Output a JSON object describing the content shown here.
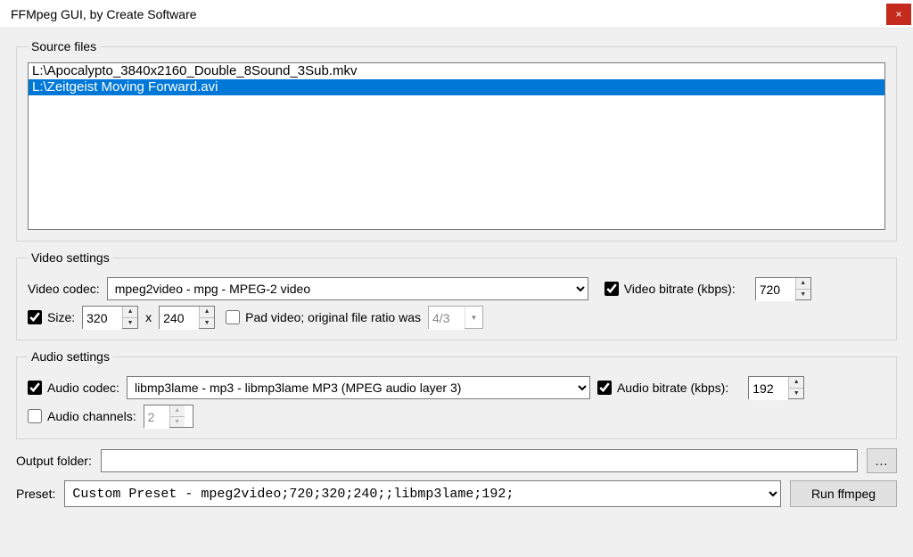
{
  "window": {
    "title": "FFMpeg GUI, by Create Software",
    "close_label": "×"
  },
  "source": {
    "legend": "Source files",
    "files": [
      "L:\\Apocalypto_3840x2160_Double_8Sound_3Sub.mkv",
      "L:\\Zeitgeist Moving Forward.avi"
    ],
    "selected_index": 1
  },
  "video": {
    "legend": "Video settings",
    "codec_label": "Video codec:",
    "codec_value": "mpeg2video - mpg - MPEG-2 video",
    "bitrate_checked": true,
    "bitrate_label": "Video bitrate (kbps):",
    "bitrate_value": "720",
    "size_checked": true,
    "size_label": "Size:",
    "size_w": "320",
    "size_sep": "x",
    "size_h": "240",
    "pad_checked": false,
    "pad_label": "Pad video; original file ratio was",
    "ratio_value": "4/3"
  },
  "audio": {
    "legend": "Audio settings",
    "codec_checked": true,
    "codec_label": "Audio codec:",
    "codec_value": "libmp3lame - mp3 - libmp3lame MP3 (MPEG audio layer 3)",
    "bitrate_checked": true,
    "bitrate_label": "Audio bitrate (kbps):",
    "bitrate_value": "192",
    "channels_checked": false,
    "channels_label": "Audio channels:",
    "channels_value": "2"
  },
  "output": {
    "label": "Output folder:",
    "value": "",
    "browse_label": "..."
  },
  "preset": {
    "label": "Preset:",
    "value": "Custom Preset - mpeg2video;720;320;240;;libmp3lame;192;",
    "run_label": "Run ffmpeg"
  }
}
